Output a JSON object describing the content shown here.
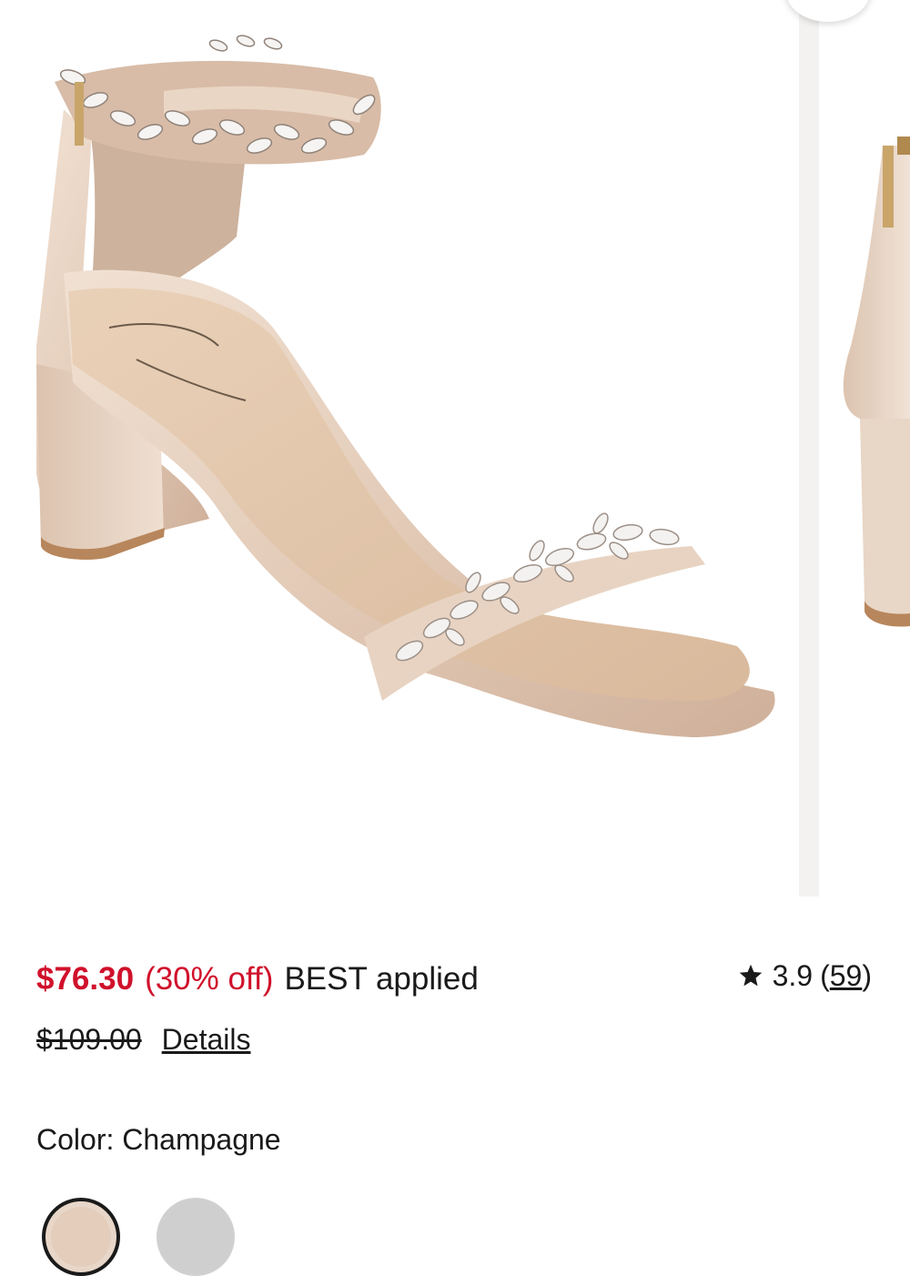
{
  "product": {
    "sale_price": "$76.30",
    "discount": "(30% off)",
    "promo": "BEST applied",
    "original_price": "$109.00",
    "details_label": "Details",
    "rating": "3.9",
    "review_open": "(",
    "review_count": "59",
    "review_close": ")",
    "color_label": "Color: Champagne"
  },
  "images": {
    "main": "champagne-sandal-photo",
    "next": "champagne-sandal-back-photo"
  },
  "swatches": [
    {
      "name": "champagne",
      "selected": true,
      "color": "#e4cdbb"
    },
    {
      "name": "silver",
      "selected": false,
      "color": "#cfcfcf"
    }
  ],
  "colors": {
    "sale": "#d0112b",
    "text": "#1a1a1a"
  },
  "icons": {
    "star": "star-icon",
    "share": "share-icon"
  }
}
